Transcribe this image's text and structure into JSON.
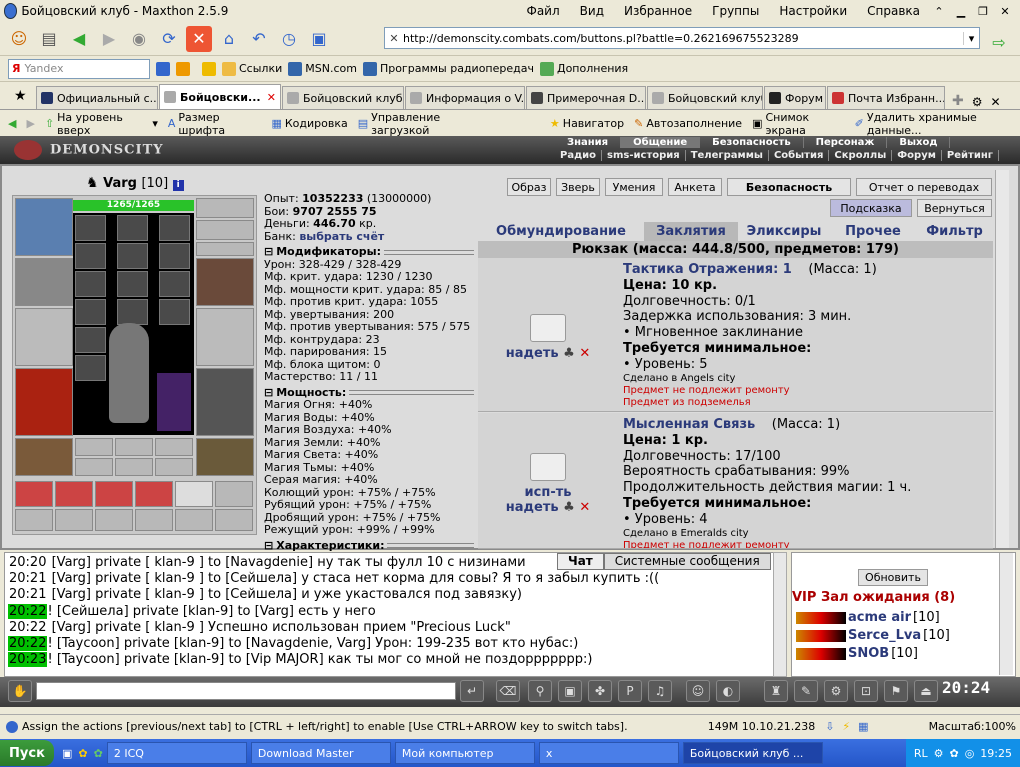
{
  "window": {
    "title": "Бойцовский клуб - Maxthon 2.5.9"
  },
  "menu": [
    "Файл",
    "Вид",
    "Избранное",
    "Группы",
    "Настройки",
    "Справка"
  ],
  "address": {
    "url": "http://demonscity.combats.com/buttons.pl?battle=0.262169675523289"
  },
  "search": {
    "engine": "Yandex"
  },
  "bookmarks": [
    "Ссылки",
    "MSN.com",
    "Программы радиопередач",
    "Дополнения"
  ],
  "tabs": [
    {
      "label": "Официальный с...",
      "active": false
    },
    {
      "label": "Бойцовски...",
      "active": true
    },
    {
      "label": "Бойцовский клуб",
      "active": false
    },
    {
      "label": "Информация о V...",
      "active": false
    },
    {
      "label": "Примерочная D...",
      "active": false
    },
    {
      "label": "Бойцовский клуб",
      "active": false
    },
    {
      "label": "Форум",
      "active": false
    },
    {
      "label": "Почта Избранн...",
      "active": false
    }
  ],
  "toolbar3": [
    "На уровень вверх",
    "Размер шрифта",
    "Кодировка",
    "Управление загрузкой",
    "Навигатор",
    "Автозаполнение",
    "Снимок экрана",
    "Удалить хранимые данные..."
  ],
  "game": {
    "logo": "DEMONSCITY",
    "top_tabs": [
      "Знания",
      "Общение",
      "Безопасность",
      "Персонаж",
      "Выход"
    ],
    "bottom_links": [
      "Радио",
      "sms-история",
      "Телеграммы",
      "События",
      "Скроллы",
      "Форум",
      "Рейтинг"
    ],
    "char_name": "Varg",
    "char_level": "[10]",
    "hp": "1265/1265",
    "stats_top": [
      {
        "label": "Опыт:",
        "value": "10352233",
        "extra": "(13000000)"
      },
      {
        "label": "Бои:",
        "value": "9707",
        "extra": "2555  75"
      },
      {
        "label": "Деньги:",
        "value": "446.70",
        "extra": "кр."
      },
      {
        "label": "Банк:",
        "value": "выбрать счёт",
        "extra": ""
      }
    ],
    "mod_header": "Модификаторы:",
    "modifiers": [
      "Урон: 328-429 / 328-429",
      "Мф. крит. удара: 1230 / 1230",
      "Мф. мощности крит. удара: 85 / 85",
      "Мф. против крит. удара: 1055",
      "Мф. увертывания: 200",
      "Мф. против увертывания: 575 / 575",
      "Мф. контрудара: 23",
      "Мф. парирования: 15",
      "Мф. блока щитом: 0",
      "Мастерство: 11 / 11"
    ],
    "power_header": "Мощность:",
    "power": [
      "Магия Огня: +40%",
      "Магия Воды: +40%",
      "Магия Воздуха: +40%",
      "Магия Земли: +40%",
      "Магия Света: +40%",
      "Магия Тьмы: +40%",
      "Серая магия: +40%",
      "Колющий урон: +75% / +75%",
      "Рубящий урон: +75% / +75%",
      "Дробящий урон: +75% / +75%",
      "Режущий урон: +99% / +99%"
    ],
    "char_header": "Характеристики:",
    "buttons_top": [
      "Образ",
      "Зверь",
      "Умения",
      "Анкета",
      "Безопасность",
      "Отчет о переводах"
    ],
    "buttons_second": [
      "Подсказка",
      "Вернуться"
    ],
    "categories": [
      "Обмундирование",
      "Заклятия",
      "Эликсиры",
      "Прочее",
      "Фильтр"
    ],
    "backpack": "Рюкзак (масса: 444.8/500, предметов: 179)",
    "items": [
      {
        "name": "Тактика Отражения: 1",
        "mass": "(Масса: 1)",
        "price": "Цена: 10 кр.",
        "lines": [
          "Долговечность: 0/1",
          "Задержка использования: 3 мин.",
          "• Мгновенное заклинание"
        ],
        "req": "Требуется минимальное:",
        "level": "• Уровень: 5",
        "made": "Сделано в Angels city",
        "warn": [
          "Предмет не подлежит ремонту",
          "Предмет из подземелья"
        ],
        "actions": [
          "надеть"
        ]
      },
      {
        "name": "Мысленная Связь",
        "mass": "(Масса: 1)",
        "price": "Цена: 1 кр.",
        "lines": [
          "Долговечность: 17/100",
          "Вероятность срабатывания: 99%",
          "Продолжительность действия магии: 1 ч."
        ],
        "req": "Требуется минимальное:",
        "level": "• Уровень: 4",
        "made": "Сделано в Emeralds city",
        "warn": [
          "Предмет не подлежит ремонту"
        ],
        "actions": [
          "исп-ть",
          "надеть"
        ]
      }
    ]
  },
  "chat": {
    "tabs": [
      "Чат",
      "Системные сообщения"
    ],
    "lines": [
      {
        "time": "20:20",
        "hl": false,
        "text": "[Varg] private [ klan-9 ] to [Navagdenie] ну так ты фулл 10 с низинами"
      },
      {
        "time": "20:21",
        "hl": false,
        "text": "[Varg] private [ klan-9 ] to [Сейшела] у стаса нет корма для совы? Я то я забыл купить :(("
      },
      {
        "time": "20:21",
        "hl": false,
        "text": "[Varg] private [ klan-9 ] to [Сейшела] и уже укастовался под завязку)"
      },
      {
        "time": "20:22",
        "hl": true,
        "text": "! [Сейшела] private [klan-9] to [Varg] есть у него"
      },
      {
        "time": "20:22",
        "hl": false,
        "text": "[Varg] private [ klan-9 ] Успешно использован прием \"Precious Luck\""
      },
      {
        "time": "20:22",
        "hl": true,
        "text": "! [Taycoon] private [klan-9] to [Navagdenie, Varg] Урон: 199-235 вот кто нубас:)"
      },
      {
        "time": "20:23",
        "hl": true,
        "text": "! [Taycoon] private [klan-9] to [Vip MAJOR] как ты мог со мной не поздоррррррр:)"
      }
    ]
  },
  "online": {
    "refresh": "Обновить",
    "room": "VIP Зал ожидания (8)",
    "users": [
      {
        "name": "acme air",
        "lvl": "[10]"
      },
      {
        "name": "Serce_Lva",
        "lvl": "[10]"
      },
      {
        "name": "SNOB",
        "lvl": "[10]"
      }
    ]
  },
  "gamebar": {
    "clock": "20:24"
  },
  "status": {
    "text": "Assign the actions [previous/next tab] to [CTRL + left/right] to enable [Use CTRL+ARROW key to switch tabs].",
    "mem": "149M 10.10.21.238",
    "zoom": "Масштаб:100%"
  },
  "taskbar": {
    "start": "Пуск",
    "items": [
      "2 ICQ",
      "Download Master",
      "Мой компьютер",
      "x",
      "Бойцовский клуб ..."
    ],
    "lang": "RL",
    "time": "19:25"
  }
}
